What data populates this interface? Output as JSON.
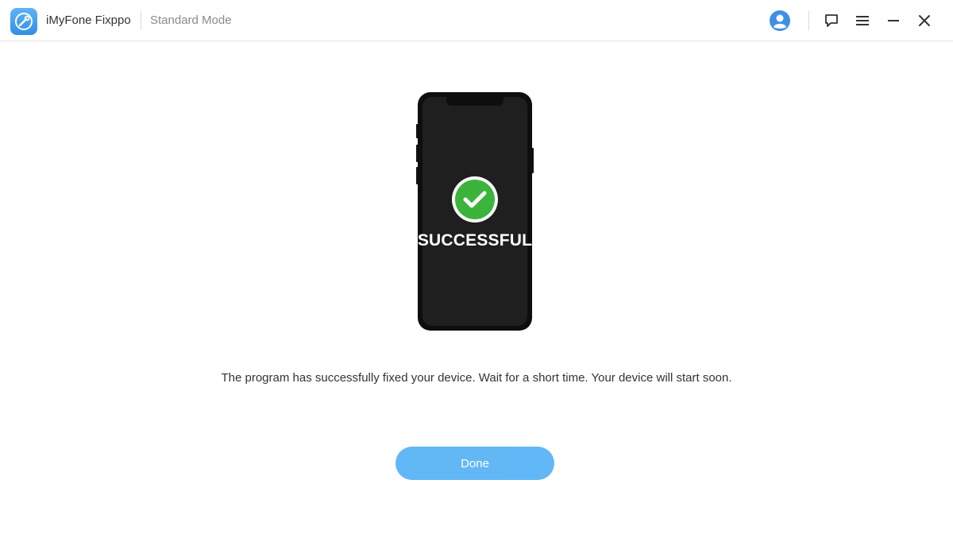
{
  "titlebar": {
    "app_name": "iMyFone Fixppo",
    "mode": "Standard Mode",
    "icons": [
      "app-logo-icon",
      "user-avatar-icon",
      "feedback-icon",
      "menu-icon",
      "minimize-icon",
      "close-icon"
    ]
  },
  "result": {
    "status": "SUCCESSFUL",
    "message": "The program has successfully fixed your device. Wait for a short time. Your device will start soon."
  },
  "actions": {
    "done_label": "Done"
  },
  "colors": {
    "accent": "#5ab4f5",
    "success": "#3cb43c",
    "phone_body": "#1c1c1c"
  }
}
